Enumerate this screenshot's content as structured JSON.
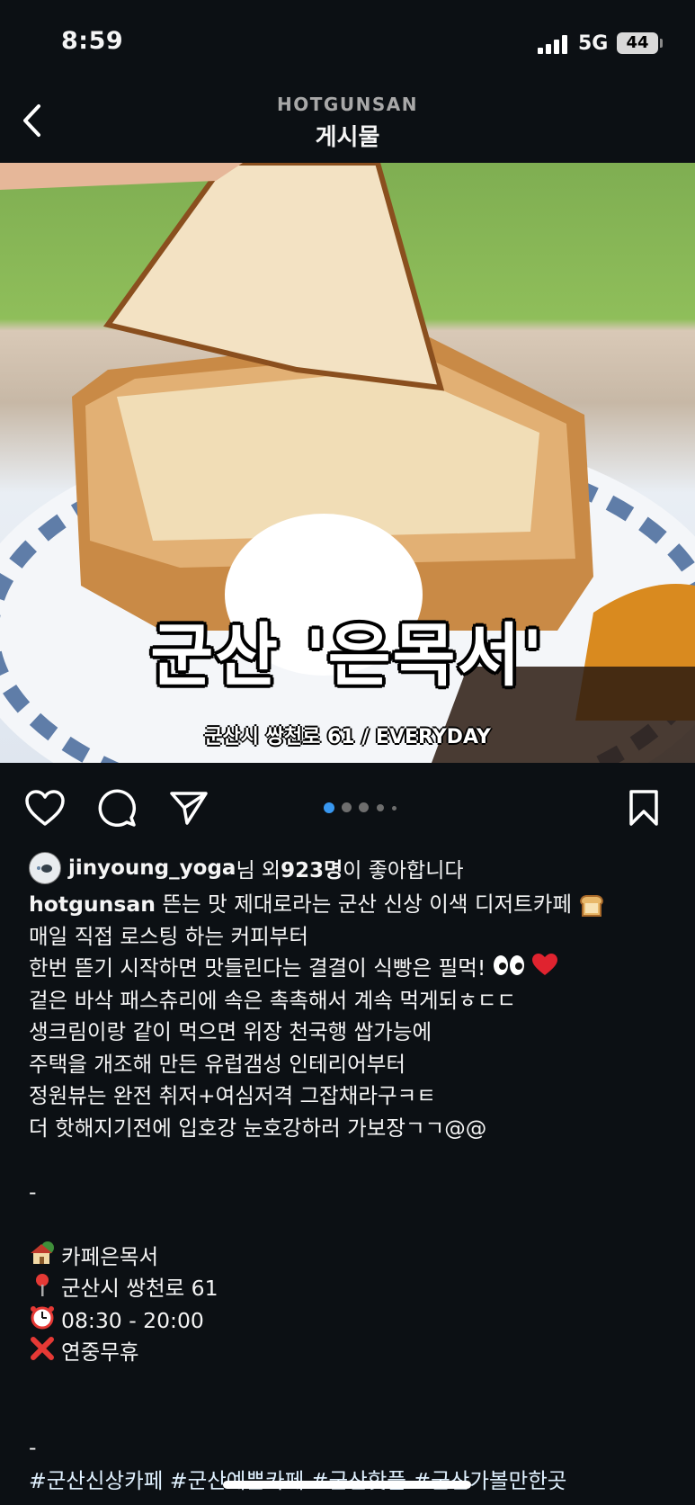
{
  "status_bar": {
    "time": "8:59",
    "network": "5G",
    "battery": "44"
  },
  "header": {
    "account": "HOTGUNSAN",
    "title": "게시물"
  },
  "post": {
    "overlay_title": "군산 '은목서'",
    "overlay_subtitle": "군산시 쌍천로 61 / EVERYDAY",
    "carousel": {
      "count": 5,
      "active": 1
    }
  },
  "likes": {
    "user": "jinyoung_yoga",
    "mid": "님 외 ",
    "count": "923명",
    "tail": "이 좋아합니다"
  },
  "caption": {
    "username": "hotgunsan",
    "first_line": " 뜬는 맛 제대로라는 군산 신상 이색 디저트카페",
    "lines": [
      "매일 직접 로스팅 하는 커피부터",
      "한번 뜯기 시작하면 맛들린다는 결결이 식빵은 필먹!",
      "겉은 바삭 패스츄리에 속은 촉촉해서 계속 먹게되ㅎㄷㄷ",
      "생크림이랑 같이 먹으면 위장 천국행 쌉가능에",
      "주택을 개조해 만든 유럽갬성 인테리어부터",
      "정원뷰는 완전 취저+여심저격 그잡채라구ㅋㅌ",
      "더 핫해지기전에 입호강 눈호강하러 가보장ㄱㄱ@@"
    ],
    "separator": "-",
    "info": [
      {
        "icon": "house-icon",
        "text": "카페은목서"
      },
      {
        "icon": "pin-icon",
        "text": "군산시 쌍천로 61"
      },
      {
        "icon": "alarm-clock-icon",
        "text": "08:30 - 20:00"
      },
      {
        "icon": "cross-mark-icon",
        "text": "연중무휴"
      }
    ],
    "separator2": "-",
    "hashtags": "#군산신상카페 #군산예쁜카페 #군산핫플 #군산가볼만한곳"
  }
}
